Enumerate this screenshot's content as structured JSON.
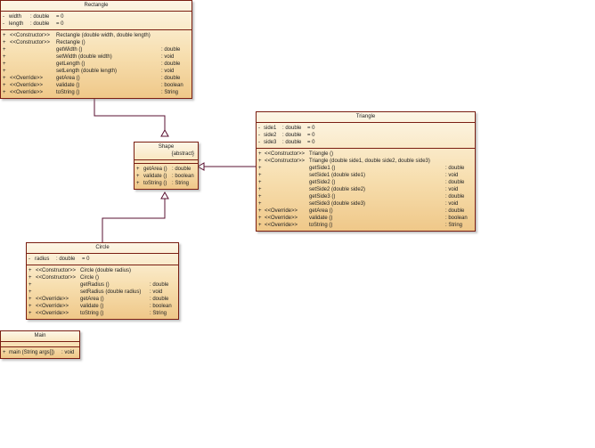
{
  "classes": {
    "rectangle": {
      "name": "Rectangle",
      "attributes": [
        {
          "vis": "-",
          "name": "width",
          "type": ": double",
          "init": "= 0"
        },
        {
          "vis": "-",
          "name": "length",
          "type": ": double",
          "init": "= 0"
        }
      ],
      "operations": [
        {
          "vis": "+",
          "stereo": "<<Constructor>>",
          "sig": "Rectangle (double width, double length)",
          "ret": ""
        },
        {
          "vis": "+",
          "stereo": "<<Constructor>>",
          "sig": "Rectangle ()",
          "ret": ""
        },
        {
          "vis": "+",
          "stereo": "",
          "sig": "getWidth ()",
          "ret": ": double"
        },
        {
          "vis": "+",
          "stereo": "",
          "sig": "setWidth (double width)",
          "ret": ": void"
        },
        {
          "vis": "+",
          "stereo": "",
          "sig": "getLength ()",
          "ret": ": double"
        },
        {
          "vis": "+",
          "stereo": "",
          "sig": "setLength (double length)",
          "ret": ": void"
        },
        {
          "vis": "+",
          "stereo": "<<Override>>",
          "sig": "getArea ()",
          "ret": ": double"
        },
        {
          "vis": "+",
          "stereo": "<<Override>>",
          "sig": "validate ()",
          "ret": ": boolean"
        },
        {
          "vis": "+",
          "stereo": "<<Override>>",
          "sig": "toString ()",
          "ret": ": String"
        }
      ]
    },
    "shape": {
      "name": "Shape",
      "stereotype": "{abstract}",
      "operations": [
        {
          "vis": "+",
          "sig": "getArea ()",
          "ret": ": double"
        },
        {
          "vis": "+",
          "sig": "validate ()",
          "ret": ": boolean"
        },
        {
          "vis": "+",
          "sig": "toString ()",
          "ret": ": String"
        }
      ]
    },
    "triangle": {
      "name": "Triangle",
      "attributes": [
        {
          "vis": "-",
          "name": "side1",
          "type": ": double",
          "init": "= 0"
        },
        {
          "vis": "-",
          "name": "side2",
          "type": ": double",
          "init": "= 0"
        },
        {
          "vis": "-",
          "name": "side3",
          "type": ": double",
          "init": "= 0"
        }
      ],
      "operations": [
        {
          "vis": "+",
          "stereo": "<<Constructor>>",
          "sig": "Triangle ()",
          "ret": ""
        },
        {
          "vis": "+",
          "stereo": "<<Constructor>>",
          "sig": "Triangle (double side1, double side2, double side3)",
          "ret": ""
        },
        {
          "vis": "+",
          "stereo": "",
          "sig": "getSide1 ()",
          "ret": ": double"
        },
        {
          "vis": "+",
          "stereo": "",
          "sig": "setSide1 (double side1)",
          "ret": ": void"
        },
        {
          "vis": "+",
          "stereo": "",
          "sig": "getSide2 ()",
          "ret": ": double"
        },
        {
          "vis": "+",
          "stereo": "",
          "sig": "setSide2 (double side2)",
          "ret": ": void"
        },
        {
          "vis": "+",
          "stereo": "",
          "sig": "getSide3 ()",
          "ret": ": double"
        },
        {
          "vis": "+",
          "stereo": "",
          "sig": "setSide3 (double side3)",
          "ret": ": void"
        },
        {
          "vis": "+",
          "stereo": "<<Override>>",
          "sig": "getArea ()",
          "ret": ": double"
        },
        {
          "vis": "+",
          "stereo": "<<Override>>",
          "sig": "validate ()",
          "ret": ": boolean"
        },
        {
          "vis": "+",
          "stereo": "<<Override>>",
          "sig": "toString ()",
          "ret": ": String"
        }
      ]
    },
    "circle": {
      "name": "Circle",
      "attributes": [
        {
          "vis": "-",
          "name": "radius",
          "type": ": double",
          "init": "= 0"
        }
      ],
      "operations": [
        {
          "vis": "+",
          "stereo": "<<Constructor>>",
          "sig": "Circle (double radius)",
          "ret": ""
        },
        {
          "vis": "+",
          "stereo": "<<Constructor>>",
          "sig": "Circle ()",
          "ret": ""
        },
        {
          "vis": "+",
          "stereo": "",
          "sig": "getRadius ()",
          "ret": ": double"
        },
        {
          "vis": "+",
          "stereo": "",
          "sig": "setRadius (double radius)",
          "ret": ": void"
        },
        {
          "vis": "+",
          "stereo": "<<Override>>",
          "sig": "getArea ()",
          "ret": ": double"
        },
        {
          "vis": "+",
          "stereo": "<<Override>>",
          "sig": "validate ()",
          "ret": ": boolean"
        },
        {
          "vis": "+",
          "stereo": "<<Override>>",
          "sig": "toString ()",
          "ret": ": String"
        }
      ]
    },
    "main": {
      "name": "Main",
      "operations": [
        {
          "vis": "+",
          "sig": "main (String args[])",
          "ret": ": void"
        }
      ]
    }
  },
  "colors": {
    "border": "#7a1e12",
    "link": "#5a1030",
    "fill_top": "#fdf6e6",
    "fill_bottom": "#efc889"
  }
}
